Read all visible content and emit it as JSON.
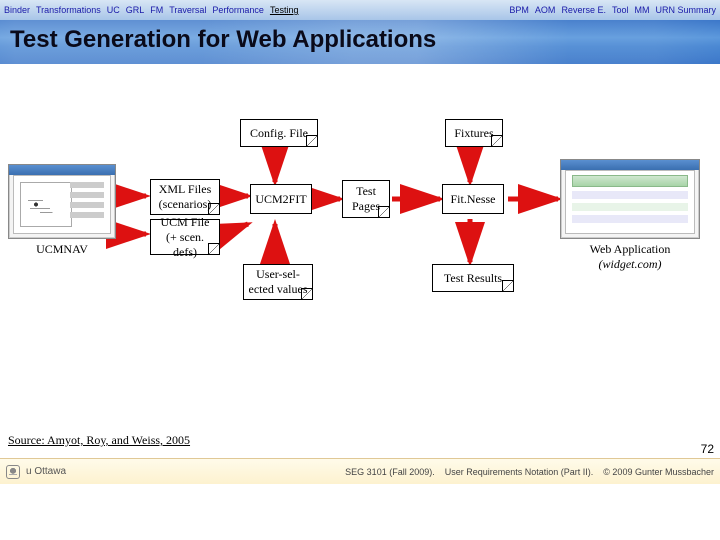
{
  "nav": {
    "left": [
      "Binder",
      "Transformations",
      "UC",
      "GRL",
      "FM",
      "Traversal",
      "Performance"
    ],
    "active": "Testing",
    "right": [
      "BPM",
      "AOM",
      "Reverse E.",
      "Tool",
      "MM",
      "URN Summary"
    ]
  },
  "title": "Test Generation for Web Applications",
  "diagram": {
    "config_file": "Config. File",
    "fixtures": "Fixtures",
    "xml_files": "XML Files\n(scenarios)",
    "ucm2fit": "UCM2FIT",
    "test_pages": "Test\nPages",
    "fitnesse": "Fit.Nesse",
    "ucm_file": "UCM File\n(+ scen. defs)",
    "user_sel": "User-sel-\nected values",
    "test_results": "Test Results",
    "ucmnav": "UCMNAV",
    "webapp_line1": "Web Application",
    "webapp_line2": "(widget.com)"
  },
  "source": "Source: Amyot, Roy, and Weiss, 2005",
  "slide_number": "72",
  "footer": {
    "uottawa": "u Ottawa",
    "course": "SEG 3101 (Fall 2009).",
    "doc": "User Requirements Notation (Part II).",
    "copyright": "© 2009 Gunter Mussbacher"
  }
}
